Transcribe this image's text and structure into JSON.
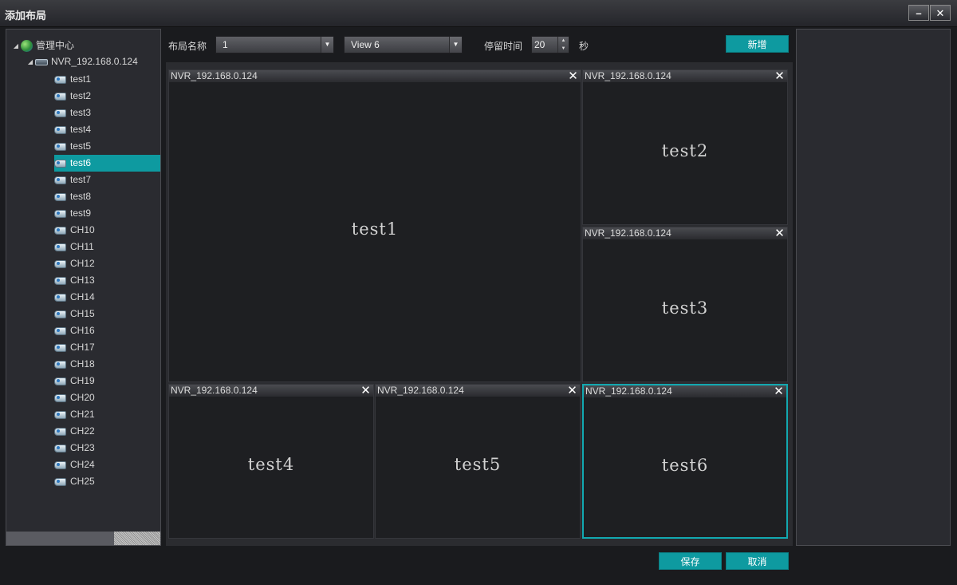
{
  "window": {
    "title": "添加布局",
    "min_label": "–",
    "close_label": "✕"
  },
  "tree": {
    "root": {
      "label": "管理中心",
      "arrow": "◢"
    },
    "nvr": {
      "label": "NVR_192.168.0.124",
      "arrow": "◢"
    },
    "items": [
      "test1",
      "test2",
      "test3",
      "test4",
      "test5",
      "test6",
      "test7",
      "test8",
      "test9",
      "CH10",
      "CH11",
      "CH12",
      "CH13",
      "CH14",
      "CH15",
      "CH16",
      "CH17",
      "CH18",
      "CH19",
      "CH20",
      "CH21",
      "CH22",
      "CH23",
      "CH24",
      "CH25"
    ],
    "selected": "test6"
  },
  "toolbar": {
    "layout_name_label": "布局名称",
    "layout_name_value": "1",
    "view_value": "View 6",
    "dwell_label": "停留时间",
    "dwell_value": "20",
    "dwell_unit": "秒",
    "add_button": "新增",
    "arrow_glyph": "▼",
    "spin_up": "▲",
    "spin_down": "▼"
  },
  "grid": {
    "source": "NVR_192.168.0.124",
    "close_glyph": "✕",
    "cells": [
      {
        "name": "test1",
        "active": false
      },
      {
        "name": "test2",
        "active": false
      },
      {
        "name": "test3",
        "active": false
      },
      {
        "name": "test4",
        "active": false
      },
      {
        "name": "test5",
        "active": false
      },
      {
        "name": "test6",
        "active": true
      }
    ]
  },
  "footer": {
    "save": "保存",
    "cancel": "取消"
  },
  "colors": {
    "accent": "#0e9aa0",
    "background": "#1a1b1e",
    "panel": "#2a2b30"
  }
}
